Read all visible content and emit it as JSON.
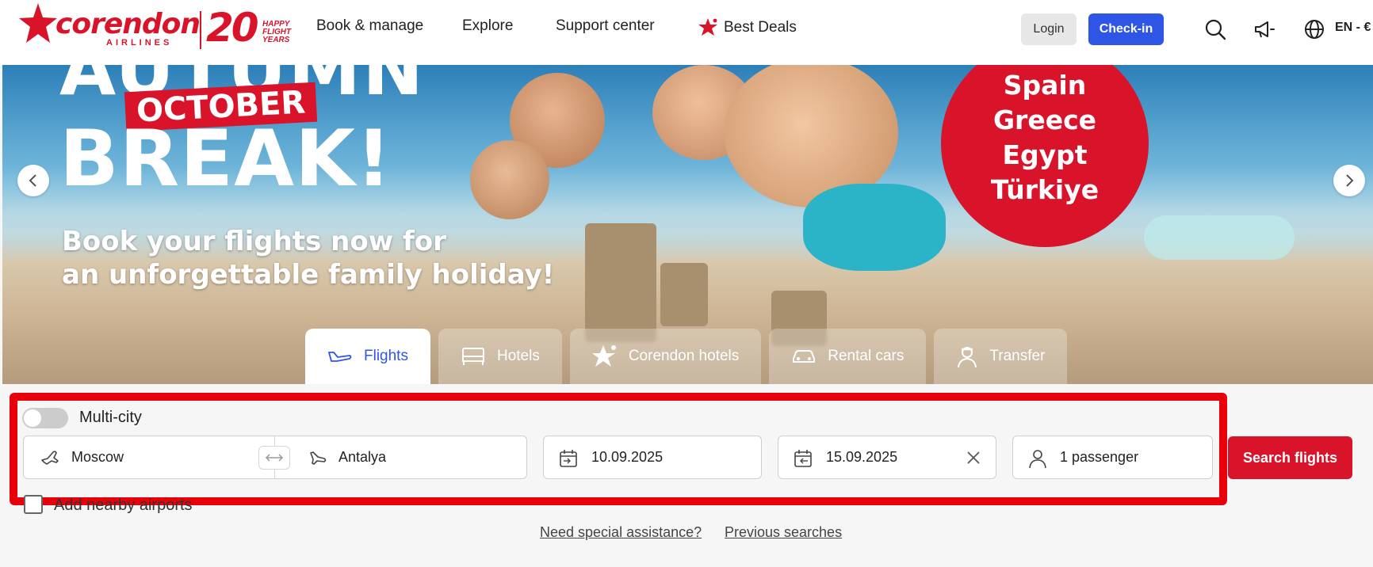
{
  "header": {
    "logo": {
      "brand": "corendon",
      "sub": "AIRLINES",
      "anniversary": "20",
      "tagline": "HAPPY FLIGHT YEARS"
    },
    "nav": [
      {
        "label": "Book & manage"
      },
      {
        "label": "Explore"
      },
      {
        "label": "Support center"
      },
      {
        "label": "Best Deals"
      }
    ],
    "login_label": "Login",
    "checkin_label": "Check-in",
    "icons": [
      "search-icon",
      "megaphone-icon",
      "globe-icon"
    ],
    "language": "EN - €"
  },
  "hero": {
    "headline_top": "AUTUMN",
    "badge": "OCTOBER",
    "headline_main": "BREAK!",
    "subline_1": "Book your flights now for",
    "subline_2": "an unforgettable family holiday!",
    "destinations": [
      "Spain",
      "Greece",
      "Egypt",
      "Türkiye"
    ]
  },
  "tabs": [
    {
      "label": "Flights",
      "icon": "plane-icon",
      "active": true
    },
    {
      "label": "Hotels",
      "icon": "bed-icon",
      "active": false
    },
    {
      "label": "Corendon hotels",
      "icon": "star-icon",
      "active": false
    },
    {
      "label": "Rental cars",
      "icon": "car-icon",
      "active": false
    },
    {
      "label": "Transfer",
      "icon": "driver-icon",
      "active": false
    }
  ],
  "search": {
    "multicity_label": "Multi-city",
    "multicity_on": false,
    "from": "Moscow",
    "to": "Antalya",
    "depart_date": "10.09.2025",
    "return_date": "15.09.2025",
    "passengers": "1 passenger",
    "search_label": "Search flights",
    "nearby_label": "Add nearby airports",
    "links": {
      "assistance": "Need special assistance?",
      "previous": "Previous searches"
    }
  },
  "colors": {
    "brand_red": "#d8132a",
    "accent_blue": "#2e55e6",
    "highlight": "#e8000a"
  }
}
